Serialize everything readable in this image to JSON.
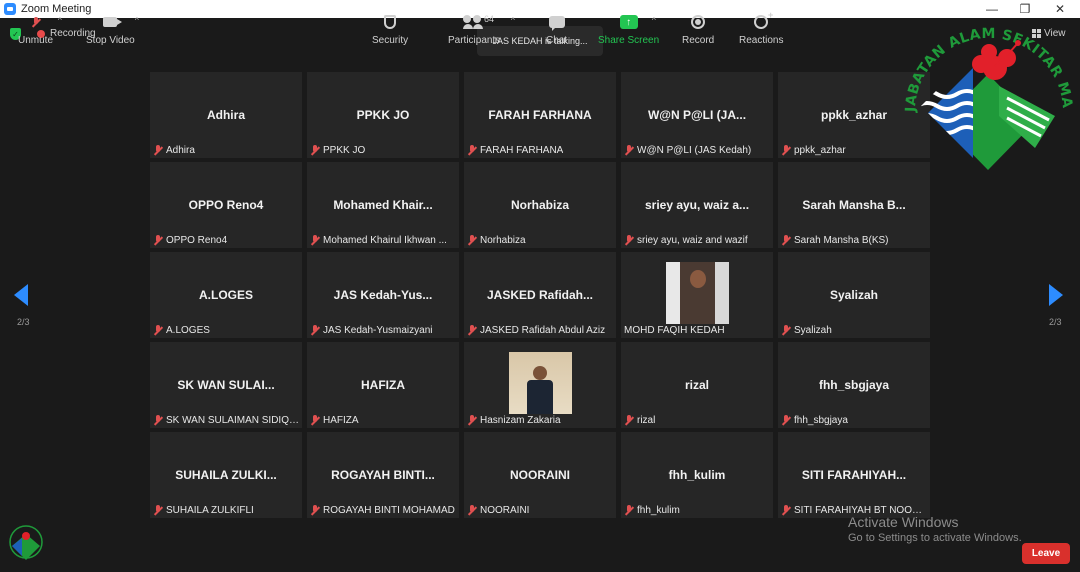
{
  "window": {
    "title": "Zoom Meeting",
    "minimize": "—",
    "maximize": "❐",
    "close": "✕"
  },
  "status": {
    "recording": "Recording",
    "talking": "JAS KEDAH is talking...",
    "view": "View"
  },
  "navigation": {
    "page": "2/3"
  },
  "logo": {
    "text": "JABATAN ALAM SEKITAR MALAYSIA",
    "colors": {
      "green": "#1f9a3a",
      "blue": "#1d5fb8",
      "red": "#e2202a"
    }
  },
  "participants": [
    {
      "tile": "Adhira",
      "caption": "Adhira"
    },
    {
      "tile": "PPKK JO",
      "caption": "PPKK JO"
    },
    {
      "tile": "FARAH FARHANA",
      "caption": "FARAH FARHANA"
    },
    {
      "tile": "W@N P@LI (JA...",
      "caption": "W@N P@LI (JAS Kedah)"
    },
    {
      "tile": "ppkk_azhar",
      "caption": "ppkk_azhar"
    },
    {
      "tile": "OPPO Reno4",
      "caption": "OPPO Reno4"
    },
    {
      "tile": "Mohamed  Khair...",
      "caption": "Mohamed Khairul Ikhwan ..."
    },
    {
      "tile": "Norhabiza",
      "caption": "Norhabiza"
    },
    {
      "tile": "sriey ayu, waiz a...",
      "caption": "sriey ayu, waiz and wazif"
    },
    {
      "tile": "Sarah Mansha B...",
      "caption": "Sarah Mansha B(KS)"
    },
    {
      "tile": "A.LOGES",
      "caption": "A.LOGES"
    },
    {
      "tile": "JAS Kedah-Yus...",
      "caption": "JAS Kedah-Yusmaizyani"
    },
    {
      "tile": "JASKED  Rafidah...",
      "caption": "JASKED Rafidah Abdul Aziz"
    },
    {
      "tile": "",
      "caption": "MOHD FAQIH KEDAH",
      "photo": "faqih",
      "muted": false
    },
    {
      "tile": "Syalizah",
      "caption": "Syalizah"
    },
    {
      "tile": "SK WAN SULAI...",
      "caption": "SK WAN SULAIMAN SIDIQ, ..."
    },
    {
      "tile": "HAFIZA",
      "caption": "HAFIZA"
    },
    {
      "tile": "",
      "caption": "Hasnizam Zakaria",
      "photo": "hasnizam"
    },
    {
      "tile": "rizal",
      "caption": "rizal"
    },
    {
      "tile": "fhh_sbgjaya",
      "caption": "fhh_sbgjaya"
    },
    {
      "tile": "SUHAILA  ZULKI...",
      "caption": "SUHAILA ZULKIFLI"
    },
    {
      "tile": "ROGAYAH  BINTI...",
      "caption": "ROGAYAH BINTI MOHAMAD"
    },
    {
      "tile": "NOORAINI",
      "caption": "NOORAINI"
    },
    {
      "tile": "fhh_kulim",
      "caption": "fhh_kulim"
    },
    {
      "tile": "SITI  FARAHIYAH...",
      "caption": "SITI FARAHIYAH BT NOOR ..."
    }
  ],
  "toolbar": {
    "unmute": "Unmute",
    "stop_video": "Stop Video",
    "security": "Security",
    "participants": "Participants",
    "participant_count": "64",
    "chat": "Chat",
    "share_screen": "Share Screen",
    "record": "Record",
    "reactions": "Reactions",
    "leave": "Leave",
    "caret": "^"
  },
  "watermark": {
    "line1": "Activate Windows",
    "line2": "Go to Settings to activate Windows."
  }
}
